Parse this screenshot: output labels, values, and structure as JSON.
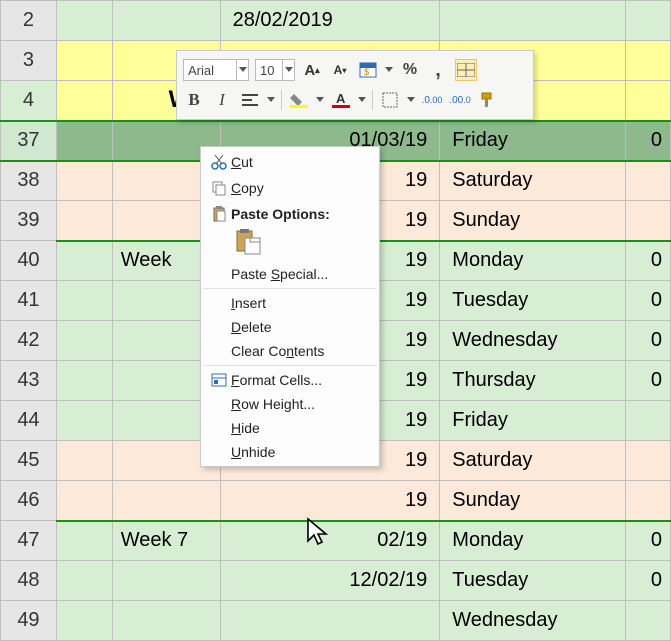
{
  "rows": {
    "r2": {
      "num": "2",
      "date": "28/02/2019"
    },
    "r3": {
      "num": "3"
    },
    "r4": {
      "num": "4",
      "wee": "Wee"
    },
    "r37": {
      "num": "37",
      "date": "01/03/19",
      "day": "Friday",
      "e": "0"
    },
    "r38": {
      "num": "38",
      "date": "19",
      "day": "Saturday"
    },
    "r39": {
      "num": "39",
      "date": "19",
      "day": "Sunday"
    },
    "r40": {
      "num": "40",
      "week": "Week",
      "date": "19",
      "day": "Monday",
      "e": "0"
    },
    "r41": {
      "num": "41",
      "date": "19",
      "day": "Tuesday",
      "e": "0"
    },
    "r42": {
      "num": "42",
      "date": "19",
      "day": "Wednesday",
      "e": "0"
    },
    "r43": {
      "num": "43",
      "date": "19",
      "day": "Thursday",
      "e": "0"
    },
    "r44": {
      "num": "44",
      "date": "19",
      "day": "Friday"
    },
    "r45": {
      "num": "45",
      "date": "19",
      "day": "Saturday"
    },
    "r46": {
      "num": "46",
      "date": "19",
      "day": "Sunday"
    },
    "r47": {
      "num": "47",
      "week": "Week 7",
      "date": "02/19",
      "day": "Monday",
      "e": "0"
    },
    "r48": {
      "num": "48",
      "date": "12/02/19",
      "day": "Tuesday",
      "e": "0"
    },
    "r49": {
      "num": "49",
      "day": "Wednesday"
    }
  },
  "mini": {
    "font": "Arial",
    "size": "10",
    "bold": "B",
    "italic": "I",
    "pct": "%",
    "comma": ","
  },
  "ctx": {
    "cut": "Cut",
    "copy": "Copy",
    "pasteopts": "Paste Options:",
    "pastesp": "Paste Special...",
    "insert": "Insert",
    "delete": "Delete",
    "clear": "Clear Contents",
    "format": "Format Cells...",
    "rowh": "Row Height...",
    "hide": "Hide",
    "unhide": "Unhide"
  }
}
